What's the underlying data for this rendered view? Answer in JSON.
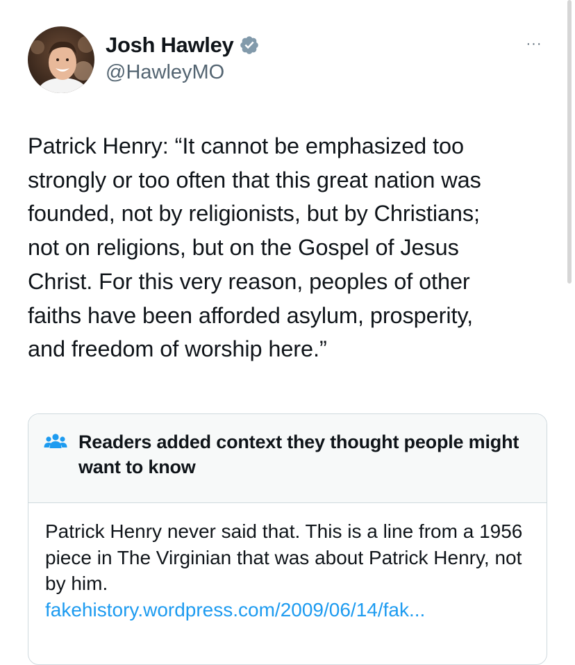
{
  "author": {
    "display_name": "Josh Hawley",
    "handle": "@HawleyMO",
    "verified": true,
    "avatar_icon": "profile-photo"
  },
  "menu": {
    "more_label": "···"
  },
  "tweet": {
    "text": "Patrick Henry: “It cannot be emphasized too\nstrongly or too often that this great nation was\nfounded, not by religionists, but by Christians;\nnot on religions, but on the Gospel of Jesus\nChrist. For this very reason, peoples of other\nfaiths have been afforded asylum, prosperity,\nand freedom of worship here.”"
  },
  "community_note": {
    "icon": "people-icon",
    "title": "Readers added context they thought people might want to know",
    "body": "Patrick Henry never said that. This is a line from a 1956 piece in The Virginian that was about Patrick Henry, not by him.",
    "link": "fakehistory.wordpress.com/2009/06/14/fak..."
  },
  "colors": {
    "text": "#0f1419",
    "secondary": "#536471",
    "link": "#1d9bf0",
    "verified_badge": "#829aab",
    "note_header_bg": "#f7f9f9",
    "border": "#cfd9de"
  }
}
